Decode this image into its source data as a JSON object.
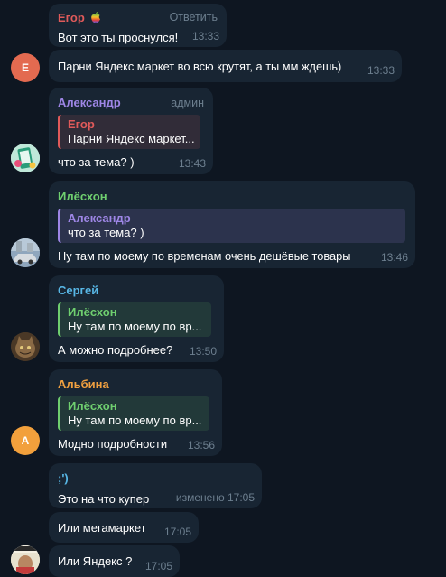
{
  "colors": {
    "background": "#0e1621",
    "bubble": "#182533",
    "meta": "#6d7f8f",
    "egor": "#e05a5a",
    "aleksandr": "#9e86e6",
    "ilyoskhon": "#6fcf6f",
    "sergey": "#58b7e6",
    "albina": "#f0a040"
  },
  "messages": [
    {
      "sender": "Егор",
      "sender_icon": "apple-icon",
      "role": "Ответить",
      "text": "Вот это ты проснулся!",
      "time": "13:33"
    },
    {
      "avatar_letter": "Е",
      "text": "Парни Яндекс маркет во всю крутят, а ты мм ждешь)",
      "time": "13:33"
    },
    {
      "sender": "Александр",
      "role": "админ",
      "reply_name": "Егор",
      "reply_text": "Парни Яндекс маркет...",
      "text": "что за тема? )",
      "time": "13:43"
    },
    {
      "sender": "Илёсхон",
      "reply_name": "Александр",
      "reply_text": "что за тема? )",
      "text": "Ну там по моему по временам очень дешёвые товары",
      "time": "13:46"
    },
    {
      "sender": "Сергей",
      "reply_name": "Илёсхон",
      "reply_text": "Ну там по моему по вр...",
      "text": "А можно подробнее?",
      "time": "13:50"
    },
    {
      "sender": "Альбина",
      "avatar_letter": "А",
      "reply_name": "Илёсхон",
      "reply_text": "Ну там по моему по вр...",
      "text": "Модно подробности",
      "time": "13:56"
    },
    {
      "sender": ";')",
      "text": "Это на что  купер",
      "time": "изменено 17:05"
    },
    {
      "text": "Или мегамаркет",
      "time": "17:05"
    },
    {
      "text": "Или Яндекс  ?",
      "time": "17:05"
    }
  ]
}
